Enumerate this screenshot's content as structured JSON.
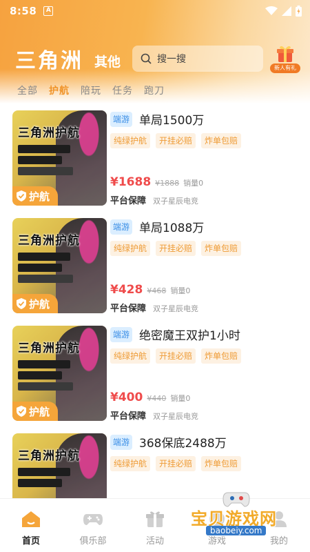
{
  "status_bar": {
    "time": "8:58",
    "a_icon": "A"
  },
  "header": {
    "brand": "三角洲",
    "other": "其他",
    "search_placeholder": "搜一搜",
    "gift_label": "新人有礼"
  },
  "tabs": [
    {
      "label": "全部",
      "active": false
    },
    {
      "label": "护航",
      "active": true
    },
    {
      "label": "陪玩",
      "active": false
    },
    {
      "label": "任务",
      "active": false
    },
    {
      "label": "跑刀",
      "active": false
    }
  ],
  "thumb": {
    "title": "三角洲护航",
    "badge": "护航"
  },
  "cards": [
    {
      "tag": "端游",
      "title": "单局1500万",
      "chips": [
        "纯绿护航",
        "开挂必赔",
        "炸单包赔"
      ],
      "price": "¥1688",
      "orig": "¥1888",
      "sold": "销量0",
      "guarantee": "平台保障",
      "shop": "双子星辰电竞"
    },
    {
      "tag": "端游",
      "title": "单局1088万",
      "chips": [
        "纯绿护航",
        "开挂必赔",
        "炸单包赔"
      ],
      "price": "¥428",
      "orig": "¥468",
      "sold": "销量0",
      "guarantee": "平台保障",
      "shop": "双子星辰电竞"
    },
    {
      "tag": "端游",
      "title": "绝密魔王双护1小时",
      "chips": [
        "纯绿护航",
        "开挂必赔",
        "炸单包赔"
      ],
      "price": "¥400",
      "orig": "¥440",
      "sold": "销量0",
      "guarantee": "平台保障",
      "shop": "双子星辰电竞"
    },
    {
      "tag": "端游",
      "title": "368保底2488万",
      "chips": [
        "纯绿护航",
        "开挂必赔",
        "炸单包赔"
      ],
      "price": "",
      "orig": "",
      "sold": "",
      "guarantee": "",
      "shop": ""
    }
  ],
  "bottom_nav": [
    {
      "label": "首页",
      "icon": "home-icon",
      "active": true
    },
    {
      "label": "俱乐部",
      "icon": "gamepad-icon",
      "active": false
    },
    {
      "label": "活动",
      "icon": "gift-icon",
      "active": false
    },
    {
      "label": "游戏",
      "icon": "game-icon",
      "active": false
    },
    {
      "label": "我的",
      "icon": "user-icon",
      "active": false
    }
  ],
  "watermark": {
    "text": "宝贝游戏网",
    "url": "baobeiy.com"
  },
  "colors": {
    "accent": "#f0942a",
    "price": "#ef4b4b",
    "chip_bg": "#fdf1e2",
    "chip_text": "#ee9b35",
    "tag_bg": "#dbeeff",
    "tag_text": "#3a8ee6"
  }
}
